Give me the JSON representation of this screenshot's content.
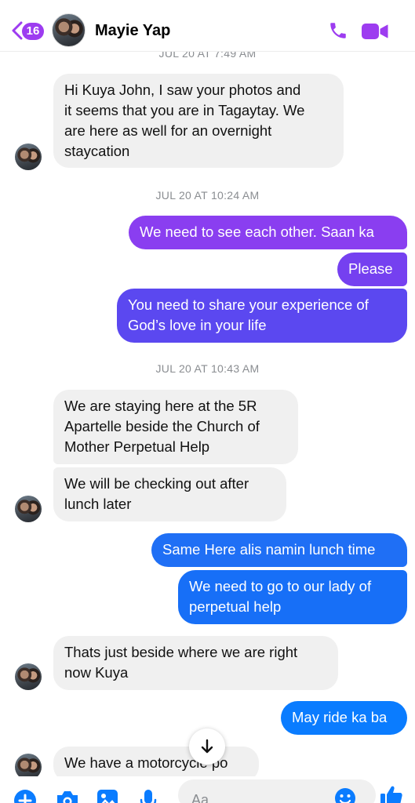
{
  "header": {
    "back_count": "16",
    "contact_name": "Mayie Yap",
    "icons": {
      "back": "chevron-left-icon",
      "call": "phone-icon",
      "video": "video-camera-icon"
    }
  },
  "colors": {
    "accent": "#9d3cf0",
    "incoming_bubble": "#f0f0f0",
    "outgoing_gradient": [
      "#8a3ef0",
      "#5b48f0",
      "#1f6ff5",
      "#0a7cff"
    ],
    "timestamp": "#8a8d91"
  },
  "thread": {
    "timestamps": [
      "JUL 20 AT 7:49 AM",
      "JUL 20 AT 10:24 AM",
      "JUL 20 AT 10:43 AM"
    ],
    "messages": [
      {
        "from": "contact",
        "text": "Hi Kuya John, I saw your photos and\nit seems that you are in Tagaytay. We\nare here as well for an overnight\nstaycation"
      },
      {
        "from": "me",
        "text": "We need to see each other. Saan ka"
      },
      {
        "from": "me",
        "text": "Please"
      },
      {
        "from": "me",
        "text": "You need to share your experience of\nGod’s love in your life"
      },
      {
        "from": "contact",
        "text": "We are staying here at the 5R\nApartelle beside the Church of\nMother Perpetual Help"
      },
      {
        "from": "contact",
        "text": "We will be checking out after\nlunch later"
      },
      {
        "from": "me",
        "text": "Same Here alis namin lunch time"
      },
      {
        "from": "me",
        "text": "We need to go to our lady of\nperpetual help"
      },
      {
        "from": "contact",
        "text": "Thats just beside where we are right\nnow Kuya"
      },
      {
        "from": "me",
        "text": "May ride ka ba"
      },
      {
        "from": "contact",
        "text": "We have a motorcycle po"
      }
    ]
  },
  "composer": {
    "placeholder": "Aa",
    "icons": [
      "plus-icon",
      "camera-icon",
      "image-icon",
      "microphone-icon",
      "emoji-icon",
      "thumbs-up-icon"
    ]
  }
}
